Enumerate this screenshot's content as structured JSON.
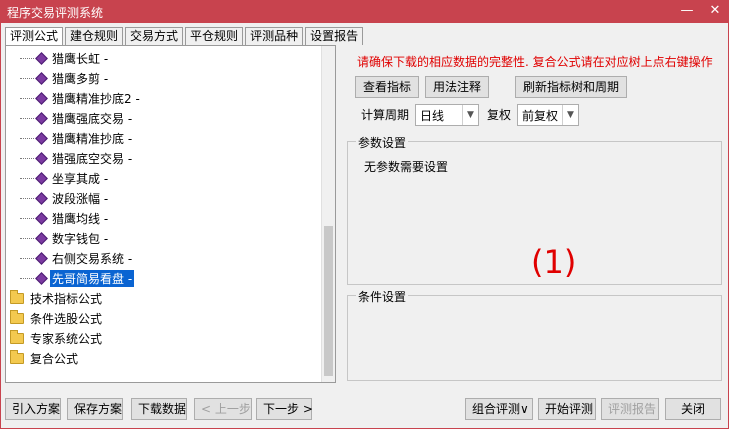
{
  "window": {
    "title": "程序交易评测系统"
  },
  "title_controls": {
    "minimize": "—",
    "close": "✕"
  },
  "tabs": [
    {
      "label": "评测公式",
      "active": true
    },
    {
      "label": "建仓规则",
      "active": false
    },
    {
      "label": "交易方式",
      "active": false
    },
    {
      "label": "平仓规则",
      "active": false
    },
    {
      "label": "评测品种",
      "active": false
    },
    {
      "label": "设置报告",
      "active": false
    }
  ],
  "tree": {
    "leaves": [
      {
        "label": "猎鹰长虹 -"
      },
      {
        "label": "猎鹰多剪 -"
      },
      {
        "label": "猎鹰精准抄底2 -"
      },
      {
        "label": "猎鹰强底交易 -"
      },
      {
        "label": "猎鹰精准抄底 -"
      },
      {
        "label": "猎强底空交易 -"
      },
      {
        "label": "坐享其成 -"
      },
      {
        "label": "波段涨幅 -"
      },
      {
        "label": "猎鹰均线 -"
      },
      {
        "label": "数字钱包 -"
      },
      {
        "label": "右侧交易系统 -"
      },
      {
        "label": "先哥简易看盘 -",
        "selected": true
      }
    ],
    "folders": [
      {
        "label": "技术指标公式"
      },
      {
        "label": "条件选股公式"
      },
      {
        "label": "专家系统公式"
      },
      {
        "label": "复合公式"
      }
    ]
  },
  "right": {
    "notice": "请确保下载的相应数据的完整性. 复合公式请在对应树上点右键操作",
    "buttons": {
      "view_indicator": "查看指标",
      "usage_note": "用法注释",
      "refresh_tree": "刷新指标树和周期"
    },
    "period_label": "计算周期",
    "period_value": "日线",
    "rights_label": "复权",
    "rights_value": "前复权",
    "params_legend": "参数设置",
    "params_text": "无参数需要设置",
    "overlay": "(1)",
    "conditions_legend": "条件设置"
  },
  "bottom": {
    "import_plan": "引入方案",
    "save_plan": "保存方案",
    "download_data": "下载数据",
    "prev_step": "< 上一步",
    "next_step": "下一步 >",
    "combo_eval": "组合评测∨",
    "start_eval": "开始评测",
    "eval_report": "评测报告",
    "close": "关闭"
  },
  "colors": {
    "titlebar": "#c8434e",
    "notice": "#e00000",
    "selected": "#0a64d2"
  }
}
